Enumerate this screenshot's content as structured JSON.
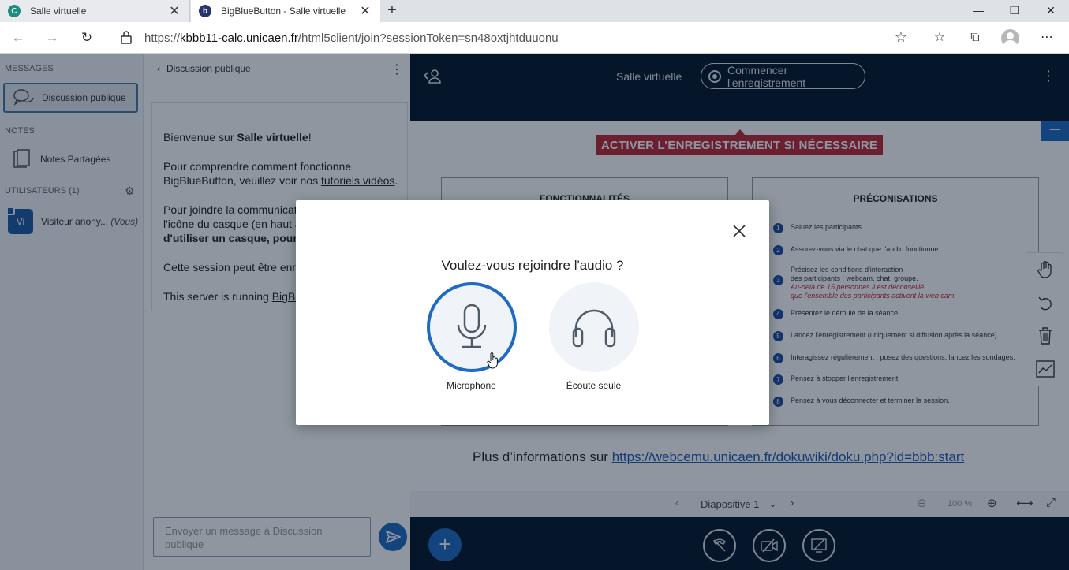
{
  "browser": {
    "tabs": [
      {
        "title": "Salle virtuelle",
        "favicon": "C"
      },
      {
        "title": "BigBlueButton - Salle virtuelle",
        "favicon": "b"
      }
    ],
    "url_prefix": "https://",
    "url_host": "kbbb11-calc.unicaen.fr",
    "url_path": "/html5client/join?sessionToken=sn48oxtjhtduuonu"
  },
  "sidebar": {
    "messages_header": "MESSAGES",
    "public_chat": "Discussion publique",
    "notes_header": "NOTES",
    "shared_notes": "Notes Partagées",
    "users_header": "UTILISATEURS (1)",
    "user": {
      "initials": "Vi",
      "name": "Visiteur anony...",
      "you": "(Vous)"
    }
  },
  "chat": {
    "header": "Discussion publique",
    "welcome_pre": "Bienvenue sur ",
    "welcome_room": "Salle virtuelle",
    "welcome_post": "!",
    "line2_pre": "Pour comprendre comment fonctionne",
    "line2_b": "BigBlueButton, veuillez voir nos ",
    "line2_link": "tutoriels vidéos",
    "line2_end": ".",
    "line3_a": "Pour joindre la communicati",
    "line3_b": "l'icône du casque (en haut à",
    "line3_c": "d'utiliser un casque, pour é",
    "line4": "Cette session peut être enreg",
    "line5_pre": "This server is running ",
    "line5_link": "BigBlu",
    "input_placeholder": "Envoyer un message à Discussion publique"
  },
  "main": {
    "room_name": "Salle virtuelle",
    "record_label": "Commencer l'enregistrement"
  },
  "slide": {
    "banner": "ACTIVER L’ENREGISTREMENT SI NÉCESSAIRE",
    "left_title": "FONCTIONNALITÉS",
    "right_title": "PRÉCONISATIONS",
    "items": [
      {
        "n": "1",
        "text": "Saluez les participants."
      },
      {
        "n": "2",
        "text": "Assurez-vous via le chat que l'audio fonctionne."
      },
      {
        "n": "3",
        "text": "Précisez les conditions d'interaction",
        "text2": "des participants : webcam, chat, groupe.",
        "red1": "Au-delà de 15 personnes il est déconseillé",
        "red2": "que l'ensemble des participants activent la web cam."
      },
      {
        "n": "4",
        "text": "Présentez le déroulé de la séance."
      },
      {
        "n": "5",
        "text": "Lancez l'enregistrement (uniquement si diffusion après la séance)."
      },
      {
        "n": "6",
        "text": "Interagissez régulièrement : posez des questions, lancez les sondages."
      },
      {
        "n": "7",
        "text": "Pensez à stopper l'enregistrement."
      },
      {
        "n": "8",
        "text": "Pensez à vous déconnecter et terminer la session."
      }
    ],
    "more_info_pre": "Plus d’informations sur ",
    "more_info_link": "https://webcemu.unicaen.fr/dokuwiki/doku.php?id=bbb:start",
    "slide_label": "Diapositive 1",
    "zoom": "100 %"
  },
  "modal": {
    "title": "Voulez-vous rejoindre l'audio ?",
    "microphone": "Microphone",
    "listen_only": "Écoute seule"
  }
}
